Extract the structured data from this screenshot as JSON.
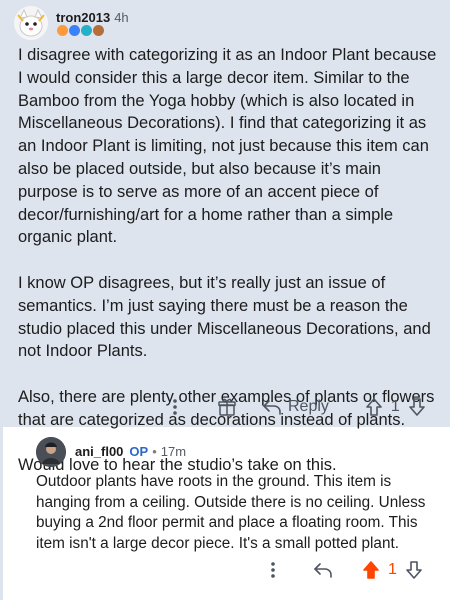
{
  "comment": {
    "author": "tron2013",
    "time": "4h",
    "badge_colors": [
      "#ff9a3c",
      "#3a82f7",
      "#22b1c9",
      "#b56e3a"
    ],
    "paragraphs": [
      "I disagree with categorizing it as an Indoor Plant because I would consider this a large decor item. Similar to the Bamboo from the Yoga hobby (which is also located in Miscellaneous Decorations). I find that categorizing it as an Indoor Plant is limiting, not just because this item can also be placed outside, but also because it’s main purpose is to serve as more of an accent piece of decor/furnishing/art for a home rather than a simple organic plant.",
      "I know OP disagrees, but it’s really just an issue of semantics. I’m just saying there must be a reason the studio placed this under Miscellaneous Decorations, and not Indoor Plants.",
      "Also, there are plenty other examples of plants or flowers that are categorized as decorations instead of plants.",
      "Would love to hear the studio’s take on this."
    ],
    "reply_label": "Reply",
    "votes": "1",
    "icons": [
      "more-vertical-icon",
      "award-icon",
      "reply-icon",
      "upvote-icon",
      "downvote-icon"
    ]
  },
  "reply": {
    "author": "ani_fl00",
    "op_label": "OP",
    "separator": "•",
    "time": "17m",
    "text": "Outdoor plants have roots in the ground. This item is hanging from a ceiling. Outside there is no ceiling. Unless buying a 2nd floor permit and place a floating room. This item isn't a large decor piece. It's a small potted plant.",
    "votes": "1",
    "upvoted": true,
    "upvote_color": "#ff4500",
    "icons": [
      "more-vertical-icon",
      "reply-icon",
      "upvote-icon",
      "downvote-icon"
    ]
  },
  "colors": {
    "highlight_bg": "#dde4ee",
    "text": "#1c1c1c",
    "muted": "#4d5561",
    "op_blue": "#2a69c7"
  }
}
